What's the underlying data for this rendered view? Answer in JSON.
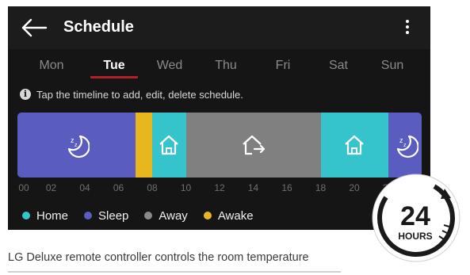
{
  "header": {
    "title": "Schedule",
    "back_icon": "arrow-left-icon",
    "menu_icon": "more-vert-icon"
  },
  "days": [
    {
      "label": "Mon",
      "active": false
    },
    {
      "label": "Tue",
      "active": true
    },
    {
      "label": "Wed",
      "active": false
    },
    {
      "label": "Thu",
      "active": false
    },
    {
      "label": "Fri",
      "active": false
    },
    {
      "label": "Sat",
      "active": false
    },
    {
      "label": "Sun",
      "active": false
    }
  ],
  "info": {
    "icon": "info-icon",
    "text": "Tap the timeline to add, edit, delete schedule."
  },
  "timeline": {
    "segments": [
      {
        "mode": "sleep",
        "start_hour": 0,
        "end_hour": 7.0,
        "icon": "sleep-icon"
      },
      {
        "mode": "awake",
        "start_hour": 7.0,
        "end_hour": 8.0,
        "icon": ""
      },
      {
        "mode": "home",
        "start_hour": 8.0,
        "end_hour": 10.0,
        "icon": "home-icon"
      },
      {
        "mode": "away",
        "start_hour": 10.0,
        "end_hour": 18.0,
        "icon": "away-icon"
      },
      {
        "mode": "home",
        "start_hour": 18.0,
        "end_hour": 22.0,
        "icon": "home-icon"
      },
      {
        "mode": "sleep",
        "start_hour": 22.0,
        "end_hour": 24.0,
        "icon": "sleep-icon"
      }
    ],
    "tick_labels": [
      "00",
      "02",
      "04",
      "06",
      "08",
      "10",
      "12",
      "14",
      "16",
      "18",
      "20",
      "22"
    ]
  },
  "legend": [
    {
      "key": "home",
      "label": "Home",
      "color": "#35c3cc"
    },
    {
      "key": "sleep",
      "label": "Sleep",
      "color": "#5a5cbf"
    },
    {
      "key": "away",
      "label": "Away",
      "color": "#8a8a8a"
    },
    {
      "key": "awake",
      "label": "Awake",
      "color": "#e8b71d"
    }
  ],
  "colors": {
    "home": "#35c3cc",
    "sleep": "#5a5cbf",
    "away": "#808080",
    "awake": "#e8b71d",
    "accent": "#b61d2a"
  },
  "badge": {
    "number": "24",
    "unit": "HOURS",
    "icon": "24-hours-clock-icon"
  },
  "caption": "LG Deluxe remote controller controls the room temperature"
}
